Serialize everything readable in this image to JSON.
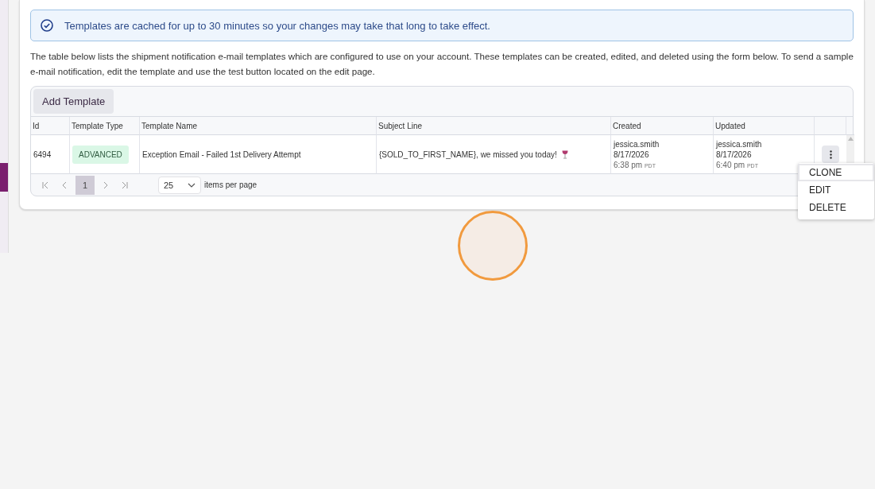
{
  "notice": {
    "text": "Templates are cached for up to 30 minutes so your changes may take that long to take effect."
  },
  "description": "The table below lists the shipment notification e-mail templates which are configured to use on your account. These templates can be created, edited, and deleted using the form below. To send a sample e-mail notification, edit the template and use the test button located on the edit page.",
  "toolbar": {
    "add_button": "Add Template"
  },
  "table": {
    "columns": [
      "Id",
      "Template Type",
      "Template Name",
      "Subject Line",
      "Created",
      "Updated"
    ],
    "rows": [
      {
        "id": "6494",
        "type": "ADVANCED",
        "name": "Exception Email - Failed 1st Delivery Attempt",
        "subject": "{SOLD_TO_FIRST_NAME}, we missed you today!",
        "created": {
          "user": "jessica.smith",
          "date": "8/17/2026",
          "time": "6:38 pm",
          "zone": "PDT"
        },
        "updated": {
          "user": "jessica.smith",
          "date": "8/17/2026",
          "time": "6:40 pm",
          "zone": "PDT"
        }
      }
    ]
  },
  "pager": {
    "pages": [
      {
        "label": "1",
        "selected": true
      }
    ],
    "page_size": "25",
    "page_size_label": "items per page"
  },
  "row_menu": [
    {
      "label": "CLONE",
      "selected": true
    },
    {
      "label": "EDIT",
      "selected": false
    },
    {
      "label": "DELETE",
      "selected": false
    }
  ]
}
